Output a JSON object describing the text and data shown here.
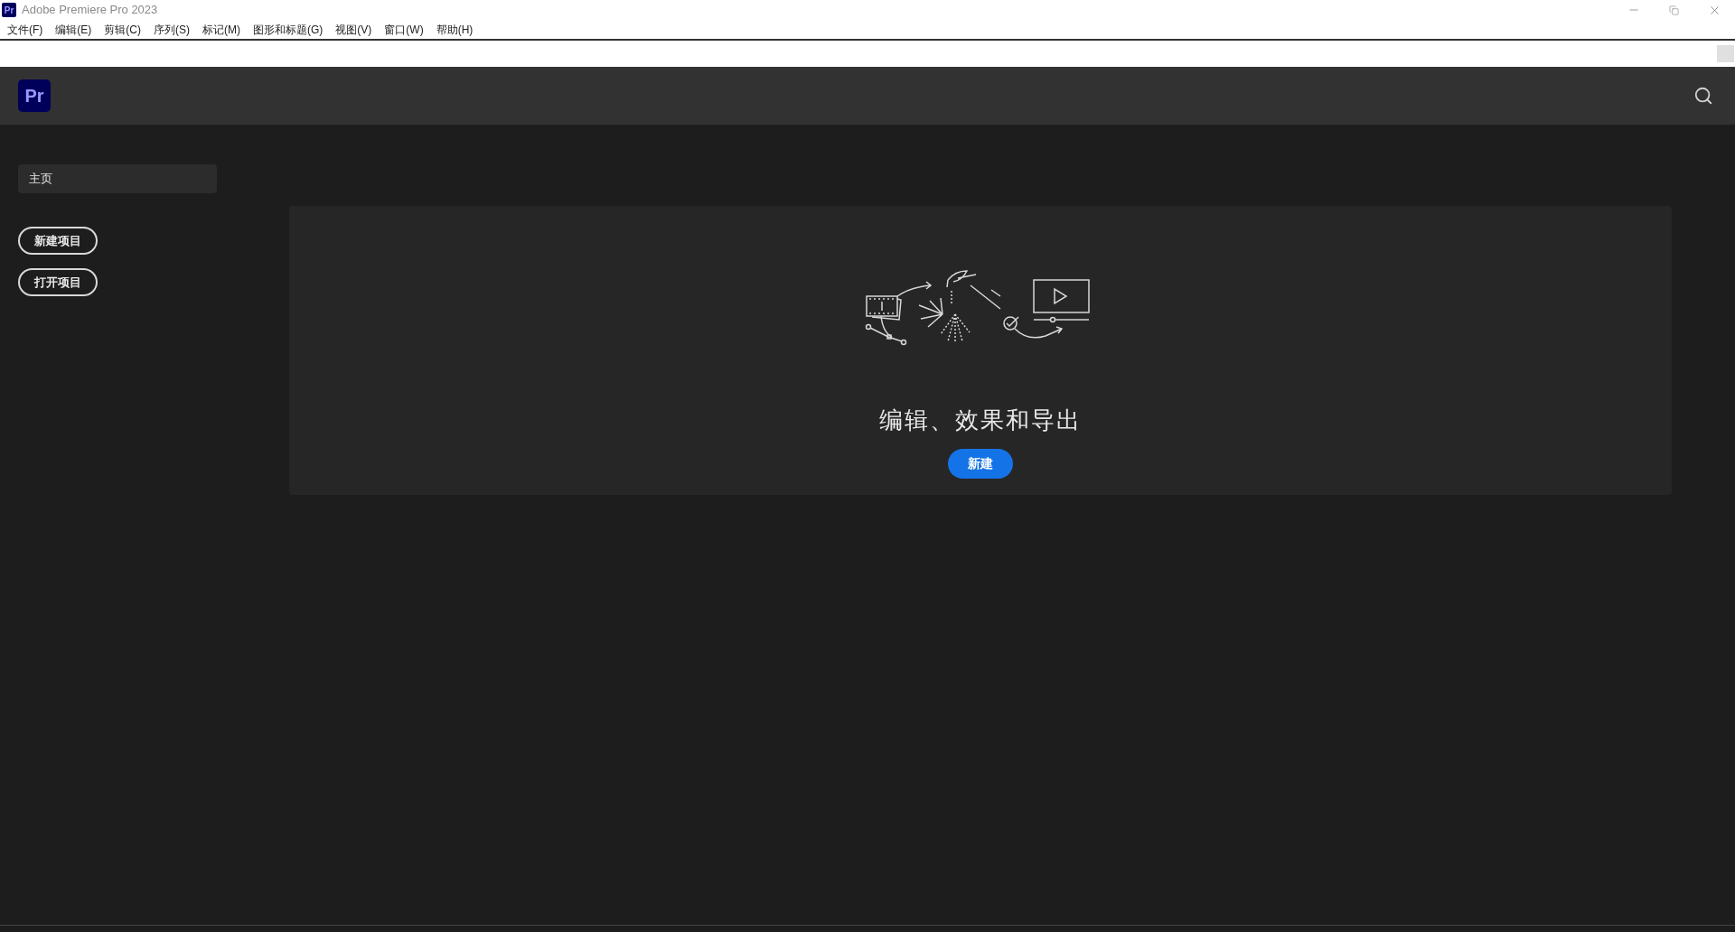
{
  "window": {
    "title": "Adobe Premiere Pro 2023",
    "app_badge": "Pr"
  },
  "menu_bar": [
    "文件(F)",
    "编辑(E)",
    "剪辑(C)",
    "序列(S)",
    "标记(M)",
    "图形和标题(G)",
    "视图(V)",
    "窗口(W)",
    "帮助(H)"
  ],
  "header": {
    "logo": "Pr"
  },
  "sidebar": {
    "items": [
      {
        "label": "主页",
        "selected": true
      }
    ],
    "buttons": [
      "新建项目",
      "打开项目"
    ]
  },
  "card": {
    "title": "编辑、效果和导出",
    "button": "新建"
  }
}
